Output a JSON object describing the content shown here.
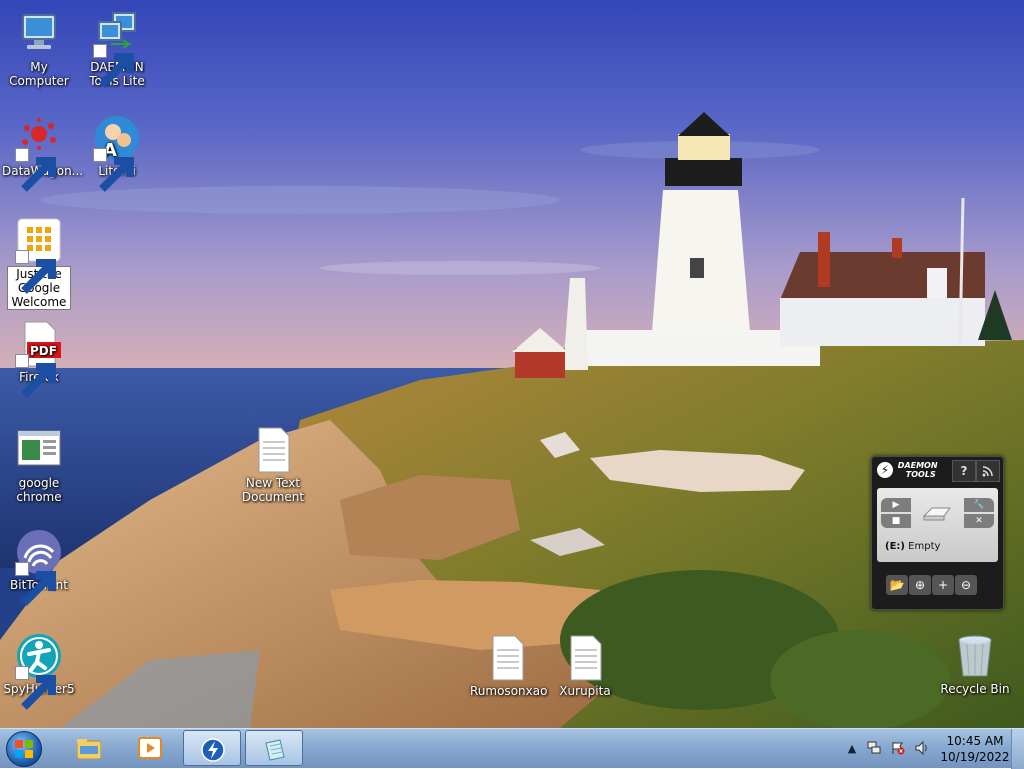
{
  "desktop": {
    "icons": [
      {
        "label": "My Computer",
        "icon": "computer-icon"
      },
      {
        "label": "DAEMON Tools Lite",
        "icon": "network-computers-icon"
      },
      {
        "label": "DataWagon...",
        "icon": "red-splash-icon"
      },
      {
        "label": "Literki",
        "icon": "cartoon-icon"
      },
      {
        "label": "Just the Google Welcome",
        "icon": "google-apps-icon"
      },
      {
        "label": "Firefox",
        "icon": "pdf-icon"
      },
      {
        "label": "google chrome",
        "icon": "document-window-icon"
      },
      {
        "label": "BitTorrent",
        "icon": "bittorrent-icon"
      },
      {
        "label": "SpyHunter5",
        "icon": "spyhunter-icon"
      },
      {
        "label": "New Text Document",
        "icon": "text-document-icon"
      },
      {
        "label": "Rumosonxao",
        "icon": "text-document-icon"
      },
      {
        "label": "Xurupita",
        "icon": "text-document-icon"
      },
      {
        "label": "Recycle Bin",
        "icon": "recycle-bin-icon"
      }
    ]
  },
  "gadget": {
    "logo_line1": "DAEMON",
    "logo_line2": "TOOLS",
    "help": "?",
    "drive": "(E:)",
    "status": "Empty"
  },
  "taskbar": {
    "items": [
      "Windows Explorer",
      "Media Player",
      "Daemon Tools",
      "Notepad"
    ],
    "clock_time": "10:45 AM",
    "clock_date": "10/19/2022"
  },
  "colors": {
    "taskbar": "#88a9d0",
    "sky": "#3c4fbf",
    "sea": "#23408a",
    "gadget_bg": "#1c1c1c"
  }
}
